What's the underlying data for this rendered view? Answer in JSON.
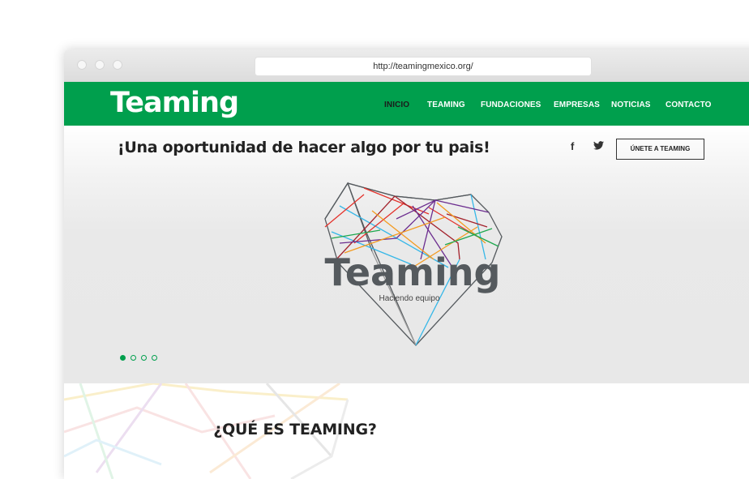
{
  "browser": {
    "url": "http://teamingmexico.org/"
  },
  "navbar": {
    "logo": "Teaming",
    "items": [
      {
        "label": "INICIO",
        "active": true
      },
      {
        "label": "TEAMING",
        "active": false
      },
      {
        "label": "FUNDACIONES",
        "active": false
      },
      {
        "label": "EMPRESAS",
        "active": false
      },
      {
        "label": "NOTICIAS",
        "active": false
      },
      {
        "label": "CONTACTO",
        "active": false
      }
    ]
  },
  "hero": {
    "tagline": "¡Una oportunidad de hacer algo por tu pais!",
    "social": {
      "facebook": "f",
      "twitter": "twitter-icon"
    },
    "cta_label": "ÚNETE A TEAMING",
    "logo_title": "Teaming",
    "logo_subtitle": "Haciendo equipo",
    "slider": {
      "count": 4,
      "active": 0
    }
  },
  "section": {
    "title": "¿QUÉ ES TEAMING?"
  },
  "colors": {
    "brand_green": "#009f4d",
    "text_dark": "#222222",
    "logo_gray": "#555a5e"
  }
}
